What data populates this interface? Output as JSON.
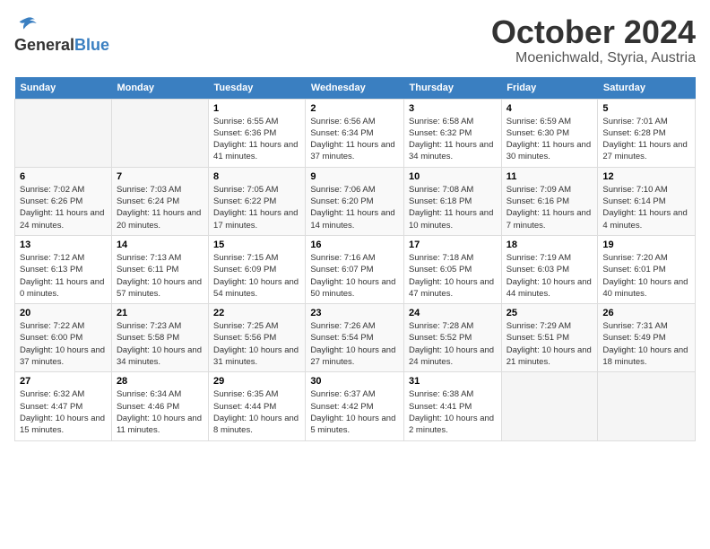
{
  "logo": {
    "general": "General",
    "blue": "Blue"
  },
  "title": "October 2024",
  "location": "Moenichwald, Styria, Austria",
  "headers": [
    "Sunday",
    "Monday",
    "Tuesday",
    "Wednesday",
    "Thursday",
    "Friday",
    "Saturday"
  ],
  "weeks": [
    [
      {
        "day": "",
        "info": ""
      },
      {
        "day": "",
        "info": ""
      },
      {
        "day": "1",
        "info": "Sunrise: 6:55 AM\nSunset: 6:36 PM\nDaylight: 11 hours and 41 minutes."
      },
      {
        "day": "2",
        "info": "Sunrise: 6:56 AM\nSunset: 6:34 PM\nDaylight: 11 hours and 37 minutes."
      },
      {
        "day": "3",
        "info": "Sunrise: 6:58 AM\nSunset: 6:32 PM\nDaylight: 11 hours and 34 minutes."
      },
      {
        "day": "4",
        "info": "Sunrise: 6:59 AM\nSunset: 6:30 PM\nDaylight: 11 hours and 30 minutes."
      },
      {
        "day": "5",
        "info": "Sunrise: 7:01 AM\nSunset: 6:28 PM\nDaylight: 11 hours and 27 minutes."
      }
    ],
    [
      {
        "day": "6",
        "info": "Sunrise: 7:02 AM\nSunset: 6:26 PM\nDaylight: 11 hours and 24 minutes."
      },
      {
        "day": "7",
        "info": "Sunrise: 7:03 AM\nSunset: 6:24 PM\nDaylight: 11 hours and 20 minutes."
      },
      {
        "day": "8",
        "info": "Sunrise: 7:05 AM\nSunset: 6:22 PM\nDaylight: 11 hours and 17 minutes."
      },
      {
        "day": "9",
        "info": "Sunrise: 7:06 AM\nSunset: 6:20 PM\nDaylight: 11 hours and 14 minutes."
      },
      {
        "day": "10",
        "info": "Sunrise: 7:08 AM\nSunset: 6:18 PM\nDaylight: 11 hours and 10 minutes."
      },
      {
        "day": "11",
        "info": "Sunrise: 7:09 AM\nSunset: 6:16 PM\nDaylight: 11 hours and 7 minutes."
      },
      {
        "day": "12",
        "info": "Sunrise: 7:10 AM\nSunset: 6:14 PM\nDaylight: 11 hours and 4 minutes."
      }
    ],
    [
      {
        "day": "13",
        "info": "Sunrise: 7:12 AM\nSunset: 6:13 PM\nDaylight: 11 hours and 0 minutes."
      },
      {
        "day": "14",
        "info": "Sunrise: 7:13 AM\nSunset: 6:11 PM\nDaylight: 10 hours and 57 minutes."
      },
      {
        "day": "15",
        "info": "Sunrise: 7:15 AM\nSunset: 6:09 PM\nDaylight: 10 hours and 54 minutes."
      },
      {
        "day": "16",
        "info": "Sunrise: 7:16 AM\nSunset: 6:07 PM\nDaylight: 10 hours and 50 minutes."
      },
      {
        "day": "17",
        "info": "Sunrise: 7:18 AM\nSunset: 6:05 PM\nDaylight: 10 hours and 47 minutes."
      },
      {
        "day": "18",
        "info": "Sunrise: 7:19 AM\nSunset: 6:03 PM\nDaylight: 10 hours and 44 minutes."
      },
      {
        "day": "19",
        "info": "Sunrise: 7:20 AM\nSunset: 6:01 PM\nDaylight: 10 hours and 40 minutes."
      }
    ],
    [
      {
        "day": "20",
        "info": "Sunrise: 7:22 AM\nSunset: 6:00 PM\nDaylight: 10 hours and 37 minutes."
      },
      {
        "day": "21",
        "info": "Sunrise: 7:23 AM\nSunset: 5:58 PM\nDaylight: 10 hours and 34 minutes."
      },
      {
        "day": "22",
        "info": "Sunrise: 7:25 AM\nSunset: 5:56 PM\nDaylight: 10 hours and 31 minutes."
      },
      {
        "day": "23",
        "info": "Sunrise: 7:26 AM\nSunset: 5:54 PM\nDaylight: 10 hours and 27 minutes."
      },
      {
        "day": "24",
        "info": "Sunrise: 7:28 AM\nSunset: 5:52 PM\nDaylight: 10 hours and 24 minutes."
      },
      {
        "day": "25",
        "info": "Sunrise: 7:29 AM\nSunset: 5:51 PM\nDaylight: 10 hours and 21 minutes."
      },
      {
        "day": "26",
        "info": "Sunrise: 7:31 AM\nSunset: 5:49 PM\nDaylight: 10 hours and 18 minutes."
      }
    ],
    [
      {
        "day": "27",
        "info": "Sunrise: 6:32 AM\nSunset: 4:47 PM\nDaylight: 10 hours and 15 minutes."
      },
      {
        "day": "28",
        "info": "Sunrise: 6:34 AM\nSunset: 4:46 PM\nDaylight: 10 hours and 11 minutes."
      },
      {
        "day": "29",
        "info": "Sunrise: 6:35 AM\nSunset: 4:44 PM\nDaylight: 10 hours and 8 minutes."
      },
      {
        "day": "30",
        "info": "Sunrise: 6:37 AM\nSunset: 4:42 PM\nDaylight: 10 hours and 5 minutes."
      },
      {
        "day": "31",
        "info": "Sunrise: 6:38 AM\nSunset: 4:41 PM\nDaylight: 10 hours and 2 minutes."
      },
      {
        "day": "",
        "info": ""
      },
      {
        "day": "",
        "info": ""
      }
    ]
  ]
}
